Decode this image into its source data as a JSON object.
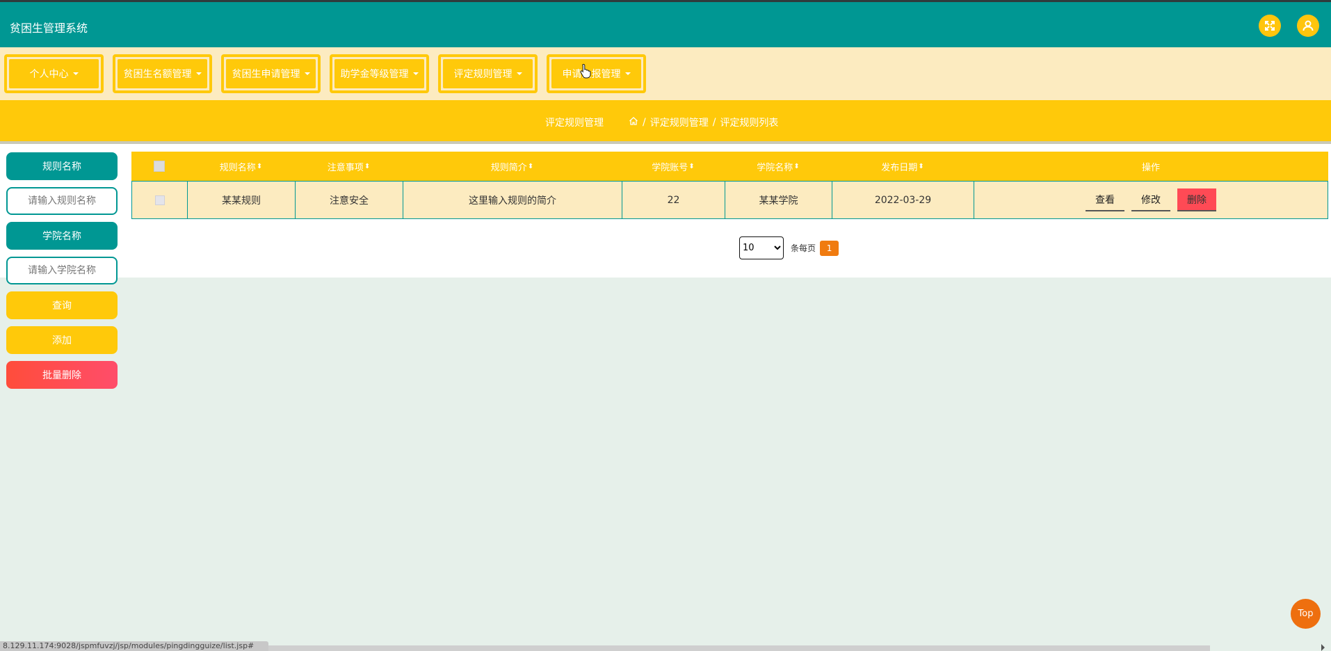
{
  "app": {
    "title": "贫困生管理系统"
  },
  "header": {
    "icons": [
      "fullscreen-icon",
      "user-icon"
    ],
    "accent": "#009793"
  },
  "nav": {
    "items": [
      {
        "label": "个人中心"
      },
      {
        "label": "贫困生名额管理"
      },
      {
        "label": "贫困生申请管理"
      },
      {
        "label": "助学金等级管理"
      },
      {
        "label": "评定规则管理"
      },
      {
        "label": "申请上报管理"
      }
    ]
  },
  "breadcrumb": {
    "title": "评定规则管理",
    "path": [
      "评定规则管理",
      "评定规则列表"
    ],
    "separator": "/"
  },
  "sidebar": {
    "rule_label": "规则名称",
    "rule_placeholder": "请输入规则名称",
    "college_label": "学院名称",
    "college_placeholder": "请输入学院名称",
    "query": "查询",
    "add": "添加",
    "batch_delete": "批量删除"
  },
  "table": {
    "headers": [
      "规则名称",
      "注意事项",
      "规则简介",
      "学院账号",
      "学院名称",
      "发布日期",
      "操作"
    ],
    "rows": [
      {
        "name": "某某规则",
        "notice": "注意安全",
        "intro": "这里输入规则的简介",
        "college_account": "22",
        "college_name": "某某学院",
        "date": "2022-03-29"
      }
    ],
    "actions": {
      "view": "查看",
      "edit": "修改",
      "delete": "删除"
    }
  },
  "pager": {
    "page_size": "10",
    "per_page_label": "条每页",
    "current_page": "1"
  },
  "top_button": "Top",
  "status_url": "8.129.11.174:9028/jspmfuvzj/jsp/modules/pingdingguize/list.jsp#",
  "colors": {
    "teal": "#009793",
    "yellow": "#ffc90a",
    "cream": "#fcebc0",
    "red": "#ff4a55",
    "orange": "#ee6f0f"
  }
}
